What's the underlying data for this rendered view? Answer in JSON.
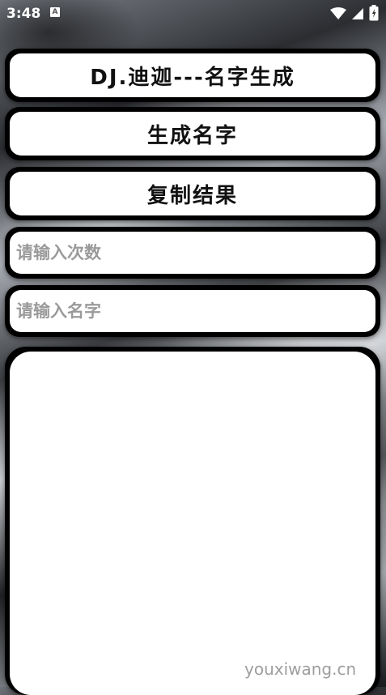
{
  "status_bar": {
    "time": "3:48",
    "notification_icon_letter": "A",
    "icons": [
      "wifi-icon",
      "signal-icon",
      "battery-icon"
    ]
  },
  "app": {
    "title": "DJ.迪迦---名字生成",
    "generate_label": "生成名字",
    "copy_label": "复制结果",
    "count_field": {
      "placeholder": "请输入次数",
      "value": ""
    },
    "name_field": {
      "placeholder": "请输入名字",
      "value": ""
    },
    "result_text": ""
  },
  "watermark": "youxiwang.cn",
  "colors": {
    "card_border": "#000000",
    "card_fill": "#ffffff",
    "placeholder": "#9a9a9a"
  }
}
